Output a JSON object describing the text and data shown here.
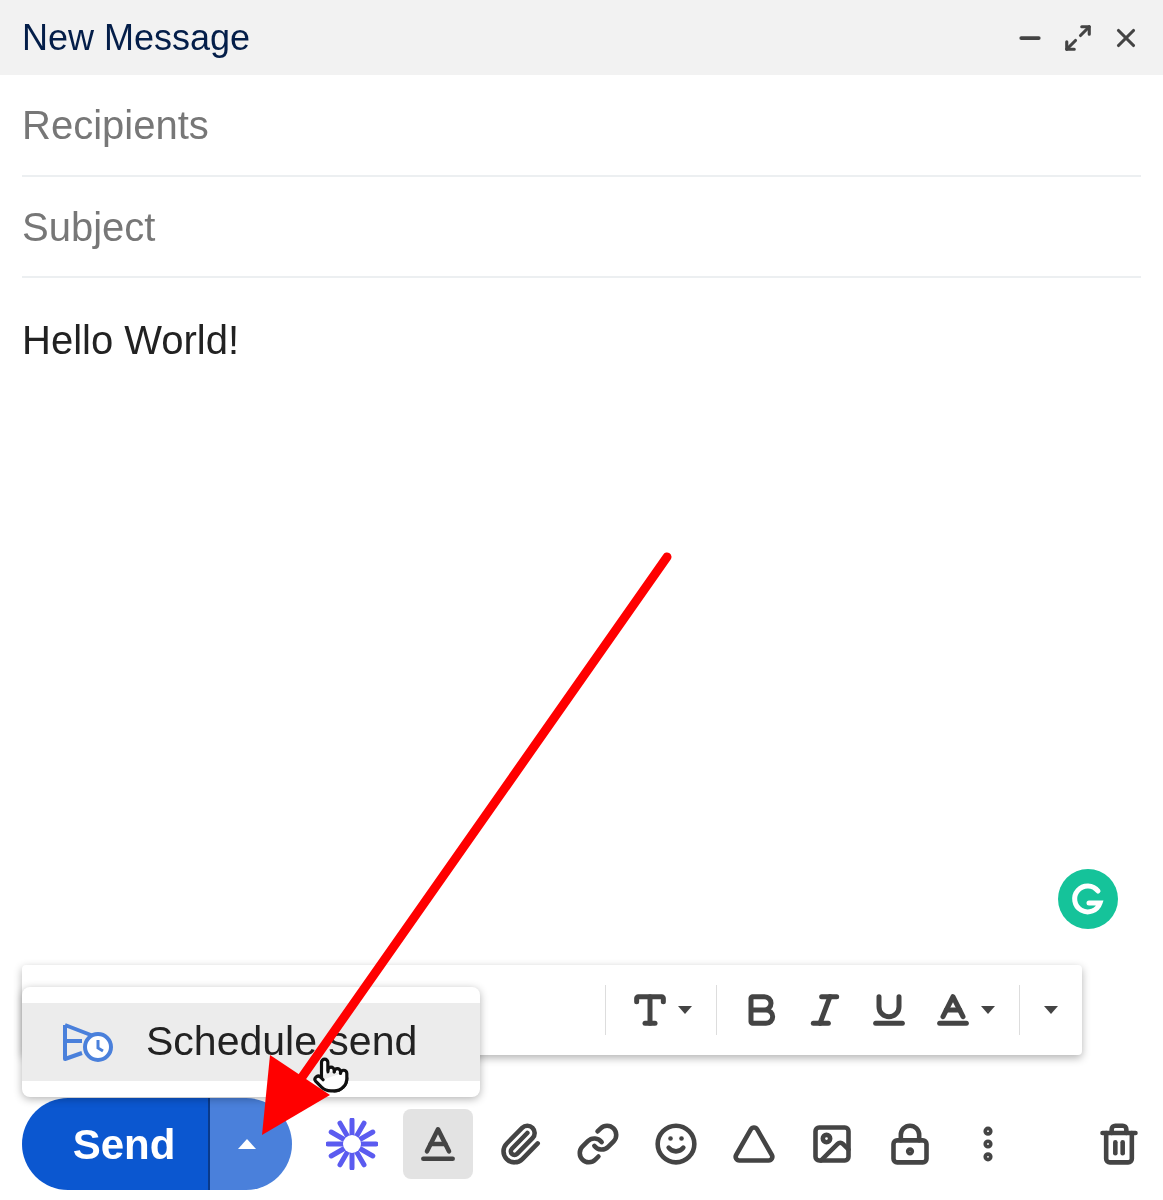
{
  "window": {
    "title": "New Message"
  },
  "recipients": {
    "placeholder": "Recipients"
  },
  "subject": {
    "placeholder": "Subject"
  },
  "body": {
    "value": "Hello World!"
  },
  "formatting_bar": {
    "visible": true
  },
  "send_menu": {
    "open": true,
    "items": [
      {
        "label": "Schedule send",
        "selected": true
      }
    ]
  },
  "send_button": {
    "label": "Send"
  },
  "formatting_toggle": {
    "on": true
  }
}
